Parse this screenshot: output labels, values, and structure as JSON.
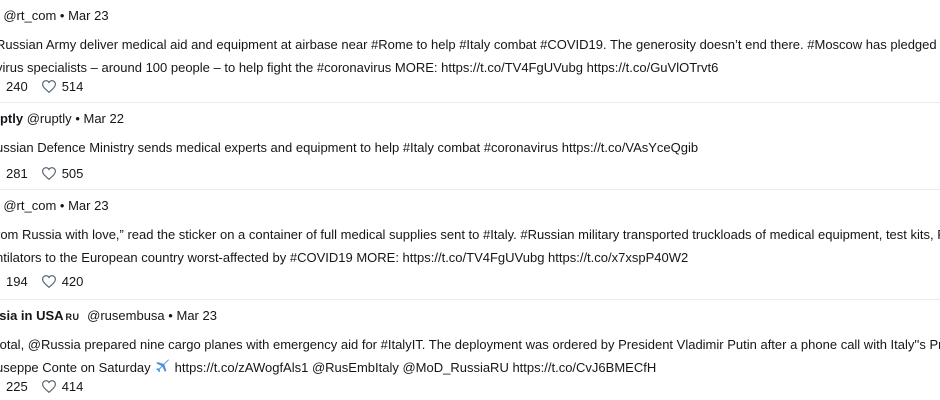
{
  "tweets": [
    {
      "header_prefix": "T",
      "name": "",
      "badge": "",
      "handle": "@rt_com",
      "separator": "•",
      "date": "Mar 23",
      "lines": [
        "Russian Army deliver medical aid and equipment at airbase near #Rome to help #Italy combat #COVID19. The generosity doesn’t end there. #Moscow has pledged to sen",
        "virus specialists – around 100 people – to help fight the #coronavirus MORE: https://t.co/TV4FgUVubg https://t.co/GuVlOTrvt6"
      ],
      "retweets": "240",
      "likes": "514"
    },
    {
      "header_prefix": "",
      "name": "uptly",
      "badge": "",
      "handle": "@ruptly",
      "separator": "•",
      "date": "Mar 22",
      "lines": [
        "ussian Defence Ministry sends medical experts and equipment to help #Italy combat #coronavirus https://t.co/VAsYceQgib"
      ],
      "retweets": "281",
      "likes": "505"
    },
    {
      "header_prefix": "T",
      "name": "",
      "badge": "",
      "handle": "@rt_com",
      "separator": "•",
      "date": "Mar 23",
      "lines": [
        "rom Russia with love,” read the sticker on a container of full medical supplies sent to #Italy. #Russian military transported truckloads of medical equipment, test kits, PPE",
        "ntilators to the European country worst-affected by #COVID19 MORE: https://t.co/TV4FgUVubg https://t.co/x7xspP40W2"
      ],
      "retweets": "194",
      "likes": "420"
    },
    {
      "header_prefix": "",
      "name": "ssia in USA",
      "badge": "RU",
      "handle": "@rusembusa",
      "separator": "•",
      "date": "Mar 23",
      "lines": [
        "total, @Russia prepared nine cargo planes with emergency aid for #ItalyIT. The deployment was ordered by President Vladimir Putin after a phone call with Italy''s Prime",
        "useppe Conte on Saturday",
        "https://t.co/zAWogfAls1 @RusEmbItaly @MoD_RussiaRU https://t.co/CvJ6BMECfH"
      ],
      "retweets": "225",
      "likes": "414"
    }
  ],
  "icons": {
    "retweet": "retweet-icon",
    "like": "heart-icon",
    "plane": "airplane-emoji"
  },
  "colors": {
    "text": "#14171a",
    "divider": "#e6ecf0",
    "icon": "#536471",
    "plane": "#4a90d9"
  }
}
